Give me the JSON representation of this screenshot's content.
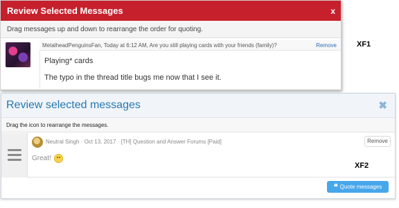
{
  "xf1": {
    "title": "Review Selected Messages",
    "close": "x",
    "instructions": "Drag messages up and down to rearrange the order for quoting.",
    "message": {
      "meta": "MetalheadPenguinsFan, Today at 6:12 AM, Are you still playing cards with your friends (family)?",
      "remove": "Remove",
      "lines": [
        "Playing* cards",
        "The typo in the thread title bugs me now that I see it."
      ]
    },
    "tag": "XF1"
  },
  "xf2": {
    "title": "Review selected messages",
    "close": "✖",
    "instructions": "Drag the icon to rearrange the messages.",
    "message": {
      "meta": "Neutral Singh · Oct 13, 2017 · [TH] Question and Answer Forums [Paid]",
      "remove": "Remove",
      "body": "Great!"
    },
    "quote_button": "Quote messages",
    "quote_icon": "❝",
    "tag": "XF2"
  },
  "colors": {
    "xf1_header": "#c6202c",
    "xf2_title": "#2577b1",
    "xf2_button": "#47a7eb"
  },
  "icons": {
    "xf1_close": "close-icon",
    "xf2_close": "close-icon",
    "drag_handle": "drag-handle-icon",
    "smiley": "smiley-icon",
    "quote": "quote-icon"
  }
}
